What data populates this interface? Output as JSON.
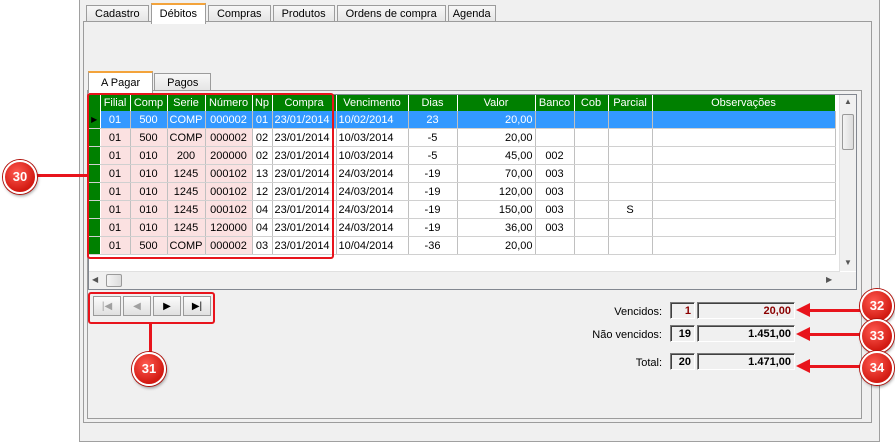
{
  "tabs": [
    "Cadastro",
    "Débitos",
    "Compras",
    "Produtos",
    "Ordens de compra",
    "Agenda"
  ],
  "active_tab": 1,
  "subtabs": [
    "A Pagar",
    "Pagos"
  ],
  "active_subtab": 0,
  "grid": {
    "columns": [
      "Filial",
      "Comp",
      "Serie",
      "Número",
      "Np",
      "Compra",
      "Vencimento",
      "Dias",
      "Valor",
      "Banco",
      "Cob",
      "Parcial",
      "Observações"
    ],
    "rows": [
      [
        "01",
        "500",
        "COMP",
        "000002",
        "01",
        "23/01/2014",
        "10/02/2014",
        "23",
        "20,00",
        "",
        "",
        "",
        ""
      ],
      [
        "01",
        "500",
        "COMP",
        "000002",
        "02",
        "23/01/2014",
        "10/03/2014",
        "-5",
        "20,00",
        "",
        "",
        "",
        ""
      ],
      [
        "01",
        "010",
        "200",
        "200000",
        "02",
        "23/01/2014",
        "10/03/2014",
        "-5",
        "45,00",
        "002",
        "",
        "",
        ""
      ],
      [
        "01",
        "010",
        "1245",
        "000102",
        "13",
        "23/01/2014",
        "24/03/2014",
        "-19",
        "70,00",
        "003",
        "",
        "",
        ""
      ],
      [
        "01",
        "010",
        "1245",
        "000102",
        "12",
        "23/01/2014",
        "24/03/2014",
        "-19",
        "120,00",
        "003",
        "",
        "",
        ""
      ],
      [
        "01",
        "010",
        "1245",
        "000102",
        "04",
        "23/01/2014",
        "24/03/2014",
        "-19",
        "150,00",
        "003",
        "",
        "S",
        ""
      ],
      [
        "01",
        "010",
        "1245",
        "120000",
        "04",
        "23/01/2014",
        "24/03/2014",
        "-19",
        "36,00",
        "003",
        "",
        "",
        ""
      ],
      [
        "01",
        "500",
        "COMP",
        "000002",
        "03",
        "23/01/2014",
        "10/04/2014",
        "-36",
        "20,00",
        "",
        "",
        "",
        ""
      ]
    ]
  },
  "summary": {
    "vencidos_label": "Vencidos:",
    "vencidos_count": "1",
    "vencidos_value": "20,00",
    "nao_vencidos_label": "Não vencidos:",
    "nao_vencidos_count": "19",
    "nao_vencidos_value": "1.451,00",
    "total_label": "Total:",
    "total_count": "20",
    "total_value": "1.471,00"
  },
  "annotations": {
    "grid": "30",
    "navigator": "31",
    "vencidos": "32",
    "nao_vencidos": "33",
    "total": "34"
  },
  "nav_icons": [
    "first-icon",
    "prior-icon",
    "next-icon",
    "last-icon"
  ],
  "colors": {
    "header": "#008000",
    "selection": "#3399ff",
    "annotation": "#e8141c",
    "vencidos_value": "#8b0000"
  }
}
